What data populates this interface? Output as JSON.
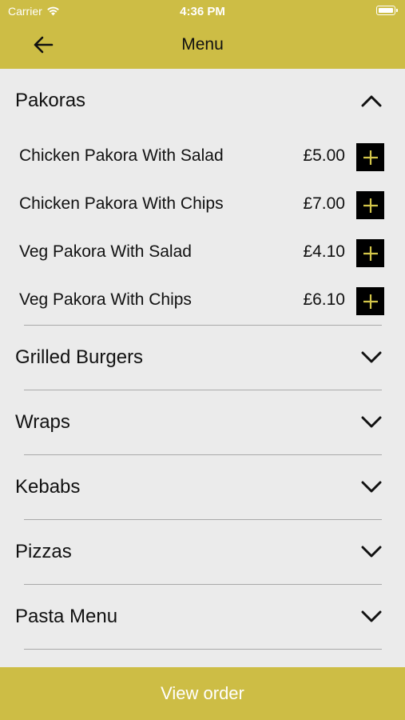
{
  "status_bar": {
    "carrier": "Carrier",
    "time": "4:36 PM"
  },
  "nav": {
    "title": "Menu"
  },
  "sections": [
    {
      "title": "Pakoras",
      "expanded": true,
      "items": [
        {
          "name": "Chicken Pakora With Salad",
          "price": "£5.00"
        },
        {
          "name": "Chicken Pakora With Chips",
          "price": "£7.00"
        },
        {
          "name": "Veg Pakora With Salad",
          "price": "£4.10"
        },
        {
          "name": "Veg Pakora With Chips",
          "price": "£6.10"
        }
      ]
    },
    {
      "title": "Grilled Burgers",
      "expanded": false
    },
    {
      "title": "Wraps",
      "expanded": false
    },
    {
      "title": "Kebabs",
      "expanded": false
    },
    {
      "title": "Pizzas",
      "expanded": false
    },
    {
      "title": "Pasta Menu",
      "expanded": false
    }
  ],
  "footer": {
    "view_order_label": "View order"
  },
  "colors": {
    "accent": "#cdbd45",
    "background": "#ebebeb",
    "add_button": "#000000",
    "add_icon": "#d4c64a"
  }
}
